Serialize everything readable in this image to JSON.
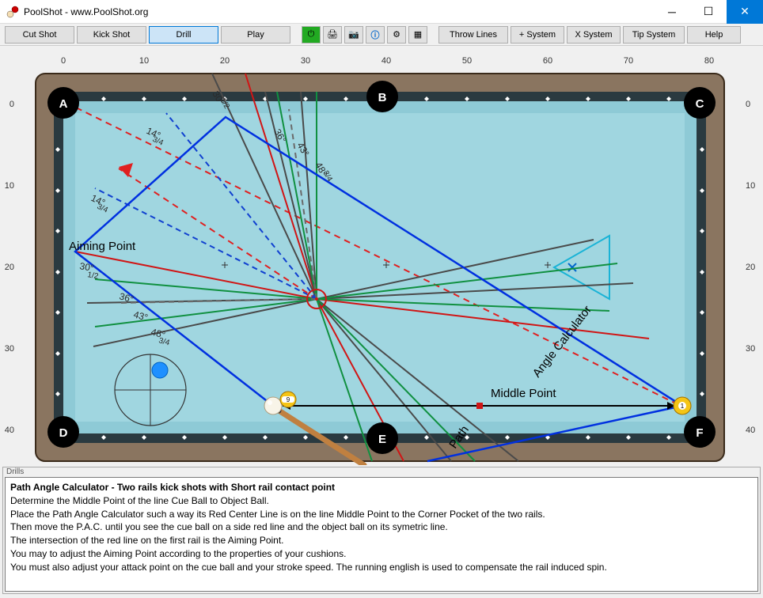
{
  "window": {
    "title": "PoolShot - www.PoolShot.org"
  },
  "toolbar": {
    "cut_shot": "Cut Shot",
    "kick_shot": "Kick Shot",
    "drill": "Drill",
    "play": "Play",
    "throw_lines": "Throw Lines",
    "plus_system": "+ System",
    "x_system": "X System",
    "tip_system": "Tip System",
    "help": "Help"
  },
  "axes": {
    "top": [
      "0",
      "10",
      "20",
      "30",
      "40",
      "50",
      "60",
      "70",
      "80"
    ],
    "left": [
      "0",
      "10",
      "20",
      "30",
      "40"
    ],
    "right": [
      "0",
      "10",
      "20",
      "30",
      "40"
    ]
  },
  "pockets": {
    "A": "A",
    "B": "B",
    "C": "C",
    "D": "D",
    "E": "E",
    "F": "F"
  },
  "labels": {
    "aiming_point": "Aiming Point",
    "middle_point": "Middle Point",
    "calc": "Angle Calculator",
    "path": "Path"
  },
  "angles": {
    "l1": "14°",
    "l1s": "3/4",
    "l2": "14°",
    "l2s": "3/4",
    "l3": "30°",
    "l3s": "1/2",
    "l4": "36°",
    "l5": "43°",
    "l6": "48°",
    "l6s": "3/4",
    "t1": "30°",
    "t1s": "1/2",
    "t2": "36°",
    "t3": "43°",
    "t4": "48°",
    "t4s": "3/4"
  },
  "drills": {
    "panel_label": "Drills",
    "title": "Path Angle Calculator - Two rails kick shots with Short rail contact point",
    "line1": "Determine the Middle Point of the line Cue Ball to Object Ball.",
    "line2": "Place the Path Angle Calculator such a way its Red Center Line is on the line Middle Point to the Corner Pocket of the two rails.",
    "line3": "Then move the P.A.C. until you see the cue ball on a side red line and the object ball on its symetric line.",
    "line4": "The intersection of the red line on the first rail is the Aiming Point.",
    "line5": "You may to adjust the Aiming Point according to the properties of your cushions.",
    "line6": "You must also adjust your attack point on the cue ball and your stroke speed. The running english is used to compensate the rail induced spin."
  }
}
